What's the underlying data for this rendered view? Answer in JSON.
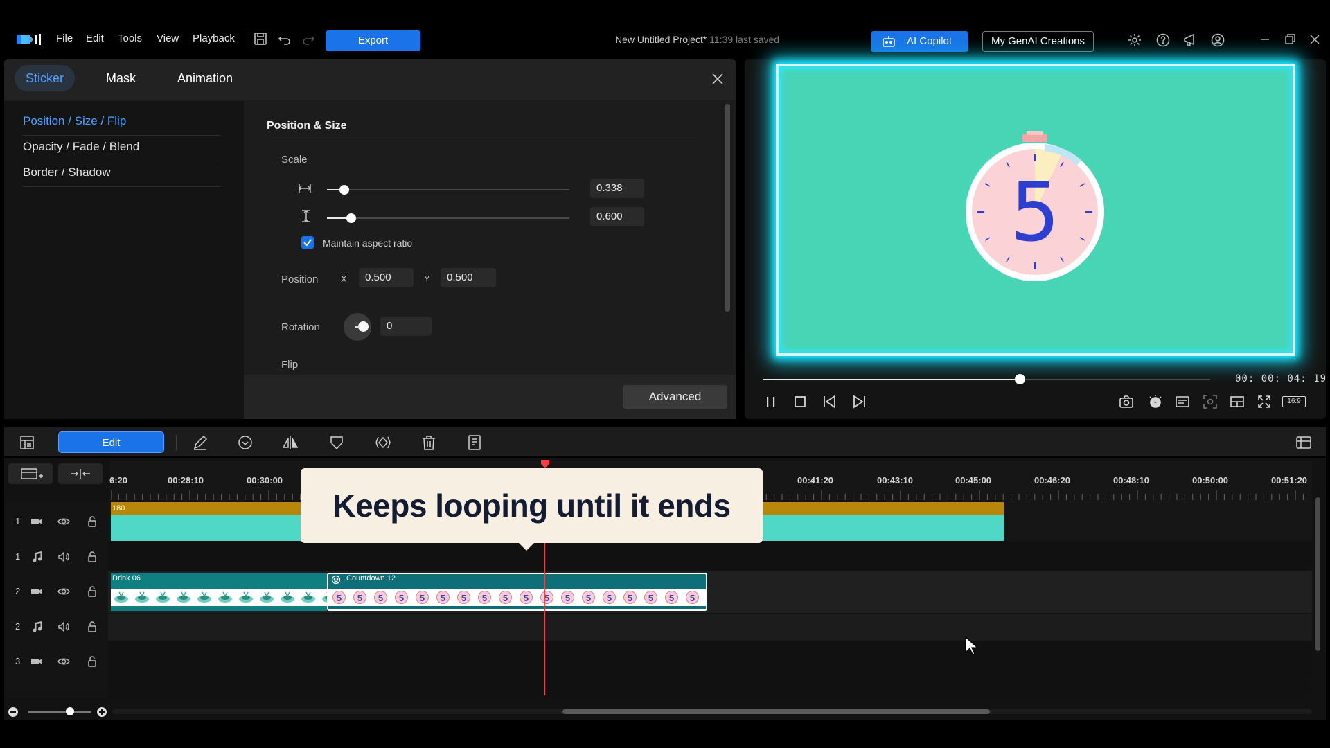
{
  "menu": {
    "items": [
      "File",
      "Edit",
      "Tools",
      "View",
      "Playback"
    ],
    "export_label": "Export"
  },
  "project": {
    "title": "New Untitled Project*",
    "saved": "11:39 last saved"
  },
  "header_buttons": {
    "ai_copilot": "AI Copilot",
    "genai": "My GenAI Creations"
  },
  "panel": {
    "tabs": [
      "Sticker",
      "Mask",
      "Animation"
    ],
    "active_tab": "Sticker",
    "categories": [
      "Position / Size / Flip",
      "Opacity / Fade / Blend",
      "Border / Shadow"
    ],
    "active_category": "Position / Size / Flip",
    "section_title": "Position & Size",
    "scale_label": "Scale",
    "scale_w": "0.338",
    "scale_h": "0.600",
    "scale_w_fraction": 0.07,
    "scale_h_fraction": 0.1,
    "maintain_aspect": "Maintain aspect ratio",
    "maintain_aspect_checked": true,
    "position_label": "Position",
    "x_label": "X",
    "y_label": "Y",
    "pos_x": "0.500",
    "pos_y": "0.500",
    "rotation_label": "Rotation",
    "rotation": "0",
    "flip_label": "Flip",
    "advanced": "Advanced"
  },
  "preview": {
    "timecode": "00: 00: 04: 19",
    "progress_fraction": 0.575,
    "clock_digit": "5",
    "aspect_label": "16:9"
  },
  "toolbar": {
    "edit_label": "Edit"
  },
  "timeline": {
    "ruler": [
      "6:20",
      "00:28:10",
      "00:30:00",
      "00:41:20",
      "00:43:10",
      "00:45:00",
      "00:46:20",
      "00:48:10",
      "00:50:00",
      "00:51:20"
    ],
    "tracks": [
      {
        "num": "1",
        "type": "video"
      },
      {
        "num": "1",
        "type": "audio"
      },
      {
        "num": "2",
        "type": "video"
      },
      {
        "num": "2",
        "type": "audio"
      },
      {
        "num": "3",
        "type": "video"
      }
    ],
    "clip_top_label": "180",
    "clip_drink_label": "Drink 06",
    "clip_countdown_label": "Countdown 12",
    "countdown_thumb_digit": "5",
    "caption": "Keeps looping until it ends"
  },
  "colors": {
    "accent": "#1a73e8",
    "preview_bg": "#47d5b6",
    "glow": "#19e9ff",
    "playhead": "#ff3b3b"
  }
}
